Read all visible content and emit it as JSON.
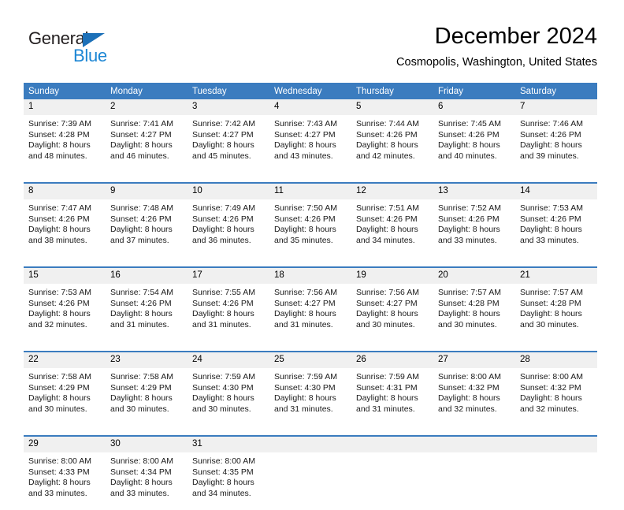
{
  "logo": {
    "word_one": "General",
    "word_two": "Blue",
    "triangle_color": "#1c70b8",
    "blue_color": "#1c86d4"
  },
  "header": {
    "title": "December 2024",
    "subtitle": "Cosmopolis, Washington, United States"
  },
  "theme": {
    "header_bg": "#3b7cbf",
    "header_text": "#ffffff",
    "daynum_bg": "#f0f0f0",
    "row_divider": "#3b7cbf"
  },
  "weekdays": [
    "Sunday",
    "Monday",
    "Tuesday",
    "Wednesday",
    "Thursday",
    "Friday",
    "Saturday"
  ],
  "weeks": [
    [
      {
        "day": "1",
        "sunrise": "Sunrise: 7:39 AM",
        "sunset": "Sunset: 4:28 PM",
        "daylight_a": "Daylight: 8 hours",
        "daylight_b": "and 48 minutes."
      },
      {
        "day": "2",
        "sunrise": "Sunrise: 7:41 AM",
        "sunset": "Sunset: 4:27 PM",
        "daylight_a": "Daylight: 8 hours",
        "daylight_b": "and 46 minutes."
      },
      {
        "day": "3",
        "sunrise": "Sunrise: 7:42 AM",
        "sunset": "Sunset: 4:27 PM",
        "daylight_a": "Daylight: 8 hours",
        "daylight_b": "and 45 minutes."
      },
      {
        "day": "4",
        "sunrise": "Sunrise: 7:43 AM",
        "sunset": "Sunset: 4:27 PM",
        "daylight_a": "Daylight: 8 hours",
        "daylight_b": "and 43 minutes."
      },
      {
        "day": "5",
        "sunrise": "Sunrise: 7:44 AM",
        "sunset": "Sunset: 4:26 PM",
        "daylight_a": "Daylight: 8 hours",
        "daylight_b": "and 42 minutes."
      },
      {
        "day": "6",
        "sunrise": "Sunrise: 7:45 AM",
        "sunset": "Sunset: 4:26 PM",
        "daylight_a": "Daylight: 8 hours",
        "daylight_b": "and 40 minutes."
      },
      {
        "day": "7",
        "sunrise": "Sunrise: 7:46 AM",
        "sunset": "Sunset: 4:26 PM",
        "daylight_a": "Daylight: 8 hours",
        "daylight_b": "and 39 minutes."
      }
    ],
    [
      {
        "day": "8",
        "sunrise": "Sunrise: 7:47 AM",
        "sunset": "Sunset: 4:26 PM",
        "daylight_a": "Daylight: 8 hours",
        "daylight_b": "and 38 minutes."
      },
      {
        "day": "9",
        "sunrise": "Sunrise: 7:48 AM",
        "sunset": "Sunset: 4:26 PM",
        "daylight_a": "Daylight: 8 hours",
        "daylight_b": "and 37 minutes."
      },
      {
        "day": "10",
        "sunrise": "Sunrise: 7:49 AM",
        "sunset": "Sunset: 4:26 PM",
        "daylight_a": "Daylight: 8 hours",
        "daylight_b": "and 36 minutes."
      },
      {
        "day": "11",
        "sunrise": "Sunrise: 7:50 AM",
        "sunset": "Sunset: 4:26 PM",
        "daylight_a": "Daylight: 8 hours",
        "daylight_b": "and 35 minutes."
      },
      {
        "day": "12",
        "sunrise": "Sunrise: 7:51 AM",
        "sunset": "Sunset: 4:26 PM",
        "daylight_a": "Daylight: 8 hours",
        "daylight_b": "and 34 minutes."
      },
      {
        "day": "13",
        "sunrise": "Sunrise: 7:52 AM",
        "sunset": "Sunset: 4:26 PM",
        "daylight_a": "Daylight: 8 hours",
        "daylight_b": "and 33 minutes."
      },
      {
        "day": "14",
        "sunrise": "Sunrise: 7:53 AM",
        "sunset": "Sunset: 4:26 PM",
        "daylight_a": "Daylight: 8 hours",
        "daylight_b": "and 33 minutes."
      }
    ],
    [
      {
        "day": "15",
        "sunrise": "Sunrise: 7:53 AM",
        "sunset": "Sunset: 4:26 PM",
        "daylight_a": "Daylight: 8 hours",
        "daylight_b": "and 32 minutes."
      },
      {
        "day": "16",
        "sunrise": "Sunrise: 7:54 AM",
        "sunset": "Sunset: 4:26 PM",
        "daylight_a": "Daylight: 8 hours",
        "daylight_b": "and 31 minutes."
      },
      {
        "day": "17",
        "sunrise": "Sunrise: 7:55 AM",
        "sunset": "Sunset: 4:26 PM",
        "daylight_a": "Daylight: 8 hours",
        "daylight_b": "and 31 minutes."
      },
      {
        "day": "18",
        "sunrise": "Sunrise: 7:56 AM",
        "sunset": "Sunset: 4:27 PM",
        "daylight_a": "Daylight: 8 hours",
        "daylight_b": "and 31 minutes."
      },
      {
        "day": "19",
        "sunrise": "Sunrise: 7:56 AM",
        "sunset": "Sunset: 4:27 PM",
        "daylight_a": "Daylight: 8 hours",
        "daylight_b": "and 30 minutes."
      },
      {
        "day": "20",
        "sunrise": "Sunrise: 7:57 AM",
        "sunset": "Sunset: 4:28 PM",
        "daylight_a": "Daylight: 8 hours",
        "daylight_b": "and 30 minutes."
      },
      {
        "day": "21",
        "sunrise": "Sunrise: 7:57 AM",
        "sunset": "Sunset: 4:28 PM",
        "daylight_a": "Daylight: 8 hours",
        "daylight_b": "and 30 minutes."
      }
    ],
    [
      {
        "day": "22",
        "sunrise": "Sunrise: 7:58 AM",
        "sunset": "Sunset: 4:29 PM",
        "daylight_a": "Daylight: 8 hours",
        "daylight_b": "and 30 minutes."
      },
      {
        "day": "23",
        "sunrise": "Sunrise: 7:58 AM",
        "sunset": "Sunset: 4:29 PM",
        "daylight_a": "Daylight: 8 hours",
        "daylight_b": "and 30 minutes."
      },
      {
        "day": "24",
        "sunrise": "Sunrise: 7:59 AM",
        "sunset": "Sunset: 4:30 PM",
        "daylight_a": "Daylight: 8 hours",
        "daylight_b": "and 30 minutes."
      },
      {
        "day": "25",
        "sunrise": "Sunrise: 7:59 AM",
        "sunset": "Sunset: 4:30 PM",
        "daylight_a": "Daylight: 8 hours",
        "daylight_b": "and 31 minutes."
      },
      {
        "day": "26",
        "sunrise": "Sunrise: 7:59 AM",
        "sunset": "Sunset: 4:31 PM",
        "daylight_a": "Daylight: 8 hours",
        "daylight_b": "and 31 minutes."
      },
      {
        "day": "27",
        "sunrise": "Sunrise: 8:00 AM",
        "sunset": "Sunset: 4:32 PM",
        "daylight_a": "Daylight: 8 hours",
        "daylight_b": "and 32 minutes."
      },
      {
        "day": "28",
        "sunrise": "Sunrise: 8:00 AM",
        "sunset": "Sunset: 4:32 PM",
        "daylight_a": "Daylight: 8 hours",
        "daylight_b": "and 32 minutes."
      }
    ],
    [
      {
        "day": "29",
        "sunrise": "Sunrise: 8:00 AM",
        "sunset": "Sunset: 4:33 PM",
        "daylight_a": "Daylight: 8 hours",
        "daylight_b": "and 33 minutes."
      },
      {
        "day": "30",
        "sunrise": "Sunrise: 8:00 AM",
        "sunset": "Sunset: 4:34 PM",
        "daylight_a": "Daylight: 8 hours",
        "daylight_b": "and 33 minutes."
      },
      {
        "day": "31",
        "sunrise": "Sunrise: 8:00 AM",
        "sunset": "Sunset: 4:35 PM",
        "daylight_a": "Daylight: 8 hours",
        "daylight_b": "and 34 minutes."
      },
      {
        "day": "",
        "sunrise": "",
        "sunset": "",
        "daylight_a": "",
        "daylight_b": ""
      },
      {
        "day": "",
        "sunrise": "",
        "sunset": "",
        "daylight_a": "",
        "daylight_b": ""
      },
      {
        "day": "",
        "sunrise": "",
        "sunset": "",
        "daylight_a": "",
        "daylight_b": ""
      },
      {
        "day": "",
        "sunrise": "",
        "sunset": "",
        "daylight_a": "",
        "daylight_b": ""
      }
    ]
  ]
}
